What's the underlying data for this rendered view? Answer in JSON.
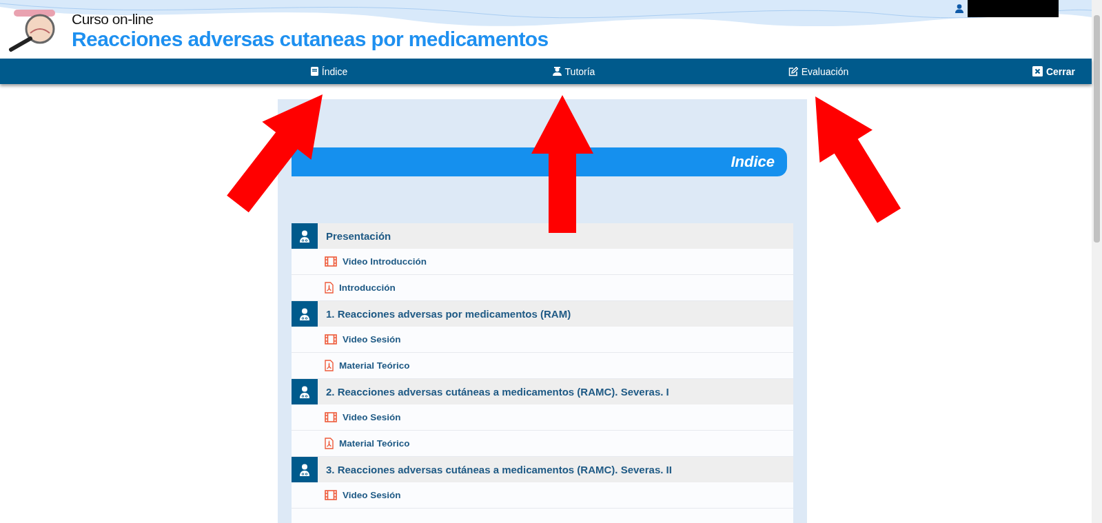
{
  "header": {
    "kicker": "Curso on-line",
    "title": "Reacciones adversas cutaneas por medicamentos"
  },
  "nav": {
    "items": [
      {
        "label": "Índice",
        "kind": "book"
      },
      {
        "label": "Tutoría",
        "kind": "tutor"
      },
      {
        "label": "Evaluación",
        "kind": "edit"
      }
    ],
    "close": "Cerrar"
  },
  "panel": {
    "banner": "Indice",
    "sections": [
      {
        "title": "Presentación",
        "items": [
          {
            "label": "Video Introducción",
            "kind": "video"
          },
          {
            "label": "Introducción",
            "kind": "pdf"
          }
        ]
      },
      {
        "title": "1. Reacciones adversas por medicamentos (RAM)",
        "items": [
          {
            "label": "Video Sesión",
            "kind": "video"
          },
          {
            "label": "Material Teórico",
            "kind": "pdf"
          }
        ]
      },
      {
        "title": "2. Reacciones adversas cutáneas a medicamentos (RAMC). Severas. I",
        "items": [
          {
            "label": "Video Sesión",
            "kind": "video"
          },
          {
            "label": "Material Teórico",
            "kind": "pdf"
          }
        ]
      },
      {
        "title": "3. Reacciones adversas cutáneas a medicamentos (RAMC). Severas. II",
        "items": [
          {
            "label": "Video Sesión",
            "kind": "video"
          }
        ]
      }
    ]
  }
}
